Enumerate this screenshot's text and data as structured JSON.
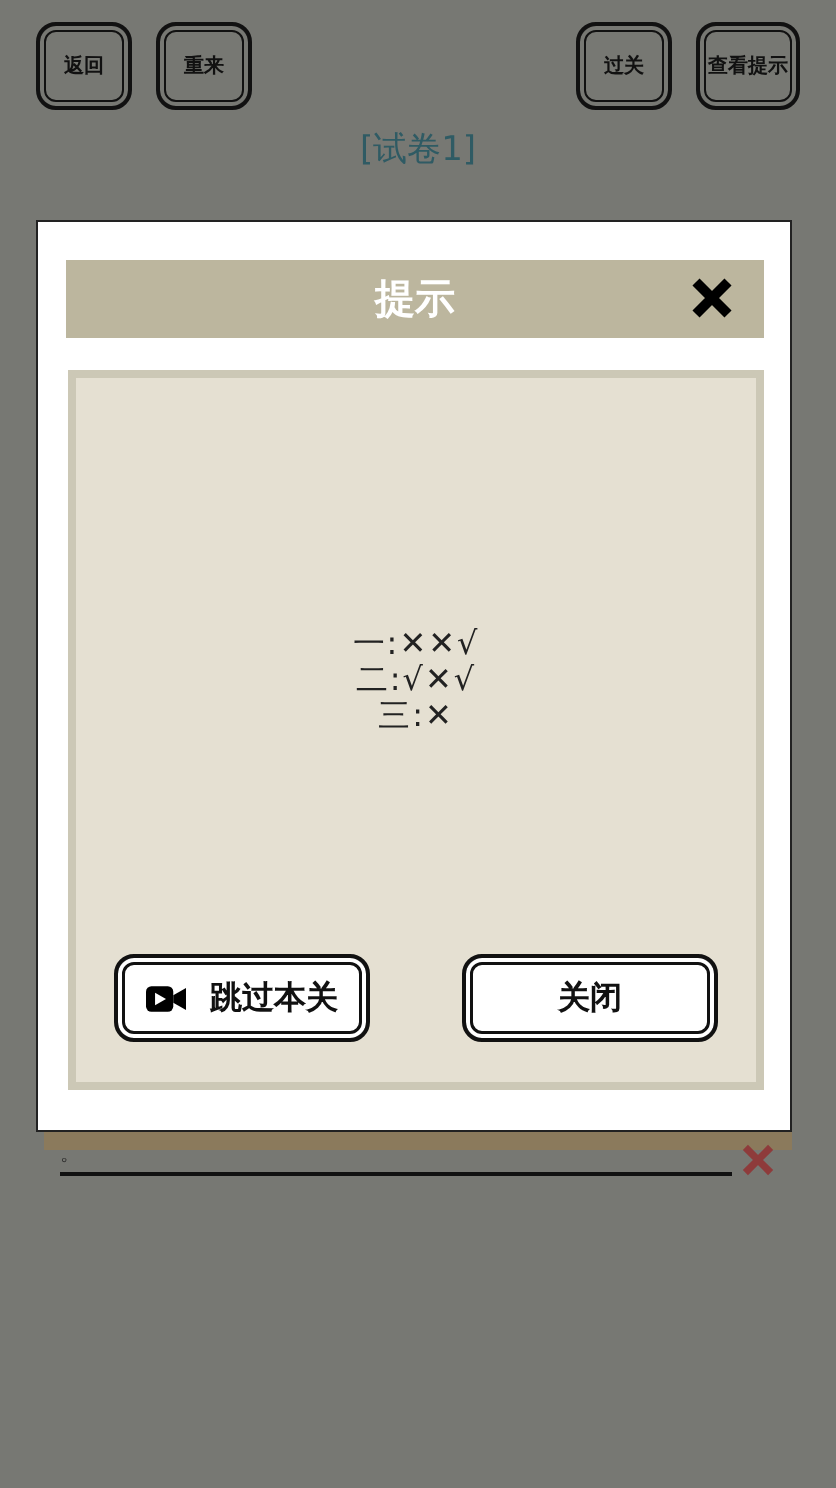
{
  "toolbar": {
    "left": [
      {
        "label": "返回"
      },
      {
        "label": "重来"
      }
    ],
    "right": [
      {
        "label": "过关"
      },
      {
        "label": "查看提示"
      }
    ]
  },
  "paper_title": "[试卷1]",
  "answer_line": {
    "text": "。",
    "wrong": true
  },
  "dialog": {
    "title": "提示",
    "hints": [
      "一:✕✕√",
      "二:√✕√",
      "三:✕"
    ],
    "buttons": [
      {
        "label": "跳过本关",
        "kind": "video"
      },
      {
        "label": "关闭",
        "kind": "plain"
      }
    ]
  }
}
